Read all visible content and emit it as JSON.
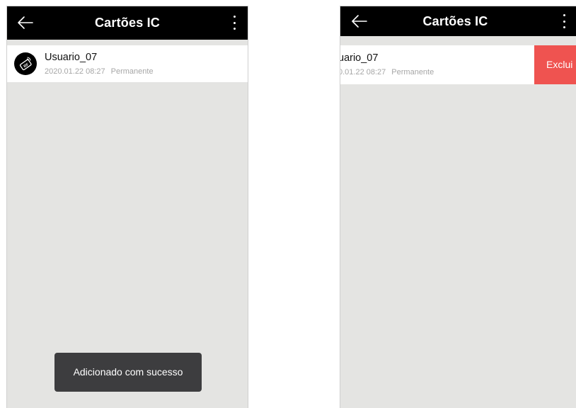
{
  "left_screen": {
    "header": {
      "title": "Cartões IC"
    },
    "card": {
      "name": "Usuario_07",
      "date": "2020.01.22 08:27",
      "validity": "Permanente"
    },
    "toast": "Adicionado com sucesso"
  },
  "right_screen": {
    "header": {
      "title": "Cartões IC"
    },
    "card": {
      "name": "uario_07",
      "date": "0.01.22 08:27",
      "validity": "Permanente"
    },
    "delete_label": "Exclui",
    "delete_color": "#ef5350"
  }
}
